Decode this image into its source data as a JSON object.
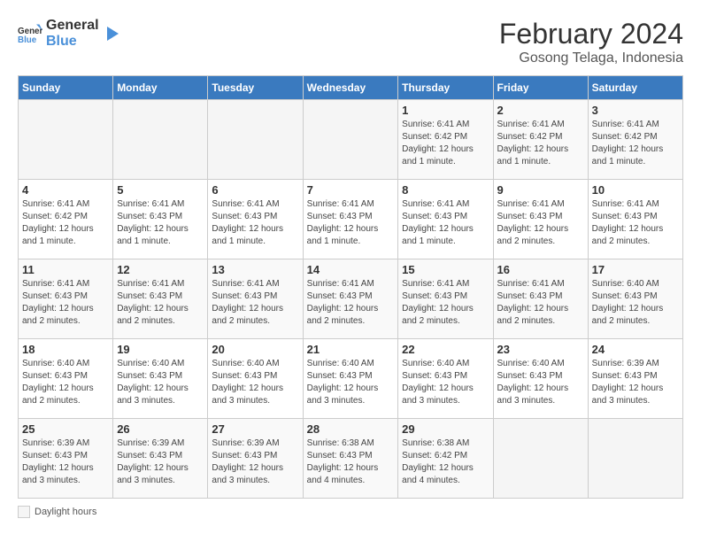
{
  "header": {
    "logo_line1": "General",
    "logo_line2": "Blue",
    "month": "February 2024",
    "location": "Gosong Telaga, Indonesia"
  },
  "days_of_week": [
    "Sunday",
    "Monday",
    "Tuesday",
    "Wednesday",
    "Thursday",
    "Friday",
    "Saturday"
  ],
  "weeks": [
    [
      {
        "num": "",
        "info": ""
      },
      {
        "num": "",
        "info": ""
      },
      {
        "num": "",
        "info": ""
      },
      {
        "num": "",
        "info": ""
      },
      {
        "num": "1",
        "info": "Sunrise: 6:41 AM\nSunset: 6:42 PM\nDaylight: 12 hours and 1 minute."
      },
      {
        "num": "2",
        "info": "Sunrise: 6:41 AM\nSunset: 6:42 PM\nDaylight: 12 hours and 1 minute."
      },
      {
        "num": "3",
        "info": "Sunrise: 6:41 AM\nSunset: 6:42 PM\nDaylight: 12 hours and 1 minute."
      }
    ],
    [
      {
        "num": "4",
        "info": "Sunrise: 6:41 AM\nSunset: 6:42 PM\nDaylight: 12 hours and 1 minute."
      },
      {
        "num": "5",
        "info": "Sunrise: 6:41 AM\nSunset: 6:43 PM\nDaylight: 12 hours and 1 minute."
      },
      {
        "num": "6",
        "info": "Sunrise: 6:41 AM\nSunset: 6:43 PM\nDaylight: 12 hours and 1 minute."
      },
      {
        "num": "7",
        "info": "Sunrise: 6:41 AM\nSunset: 6:43 PM\nDaylight: 12 hours and 1 minute."
      },
      {
        "num": "8",
        "info": "Sunrise: 6:41 AM\nSunset: 6:43 PM\nDaylight: 12 hours and 1 minute."
      },
      {
        "num": "9",
        "info": "Sunrise: 6:41 AM\nSunset: 6:43 PM\nDaylight: 12 hours and 2 minutes."
      },
      {
        "num": "10",
        "info": "Sunrise: 6:41 AM\nSunset: 6:43 PM\nDaylight: 12 hours and 2 minutes."
      }
    ],
    [
      {
        "num": "11",
        "info": "Sunrise: 6:41 AM\nSunset: 6:43 PM\nDaylight: 12 hours and 2 minutes."
      },
      {
        "num": "12",
        "info": "Sunrise: 6:41 AM\nSunset: 6:43 PM\nDaylight: 12 hours and 2 minutes."
      },
      {
        "num": "13",
        "info": "Sunrise: 6:41 AM\nSunset: 6:43 PM\nDaylight: 12 hours and 2 minutes."
      },
      {
        "num": "14",
        "info": "Sunrise: 6:41 AM\nSunset: 6:43 PM\nDaylight: 12 hours and 2 minutes."
      },
      {
        "num": "15",
        "info": "Sunrise: 6:41 AM\nSunset: 6:43 PM\nDaylight: 12 hours and 2 minutes."
      },
      {
        "num": "16",
        "info": "Sunrise: 6:41 AM\nSunset: 6:43 PM\nDaylight: 12 hours and 2 minutes."
      },
      {
        "num": "17",
        "info": "Sunrise: 6:40 AM\nSunset: 6:43 PM\nDaylight: 12 hours and 2 minutes."
      }
    ],
    [
      {
        "num": "18",
        "info": "Sunrise: 6:40 AM\nSunset: 6:43 PM\nDaylight: 12 hours and 2 minutes."
      },
      {
        "num": "19",
        "info": "Sunrise: 6:40 AM\nSunset: 6:43 PM\nDaylight: 12 hours and 3 minutes."
      },
      {
        "num": "20",
        "info": "Sunrise: 6:40 AM\nSunset: 6:43 PM\nDaylight: 12 hours and 3 minutes."
      },
      {
        "num": "21",
        "info": "Sunrise: 6:40 AM\nSunset: 6:43 PM\nDaylight: 12 hours and 3 minutes."
      },
      {
        "num": "22",
        "info": "Sunrise: 6:40 AM\nSunset: 6:43 PM\nDaylight: 12 hours and 3 minutes."
      },
      {
        "num": "23",
        "info": "Sunrise: 6:40 AM\nSunset: 6:43 PM\nDaylight: 12 hours and 3 minutes."
      },
      {
        "num": "24",
        "info": "Sunrise: 6:39 AM\nSunset: 6:43 PM\nDaylight: 12 hours and 3 minutes."
      }
    ],
    [
      {
        "num": "25",
        "info": "Sunrise: 6:39 AM\nSunset: 6:43 PM\nDaylight: 12 hours and 3 minutes."
      },
      {
        "num": "26",
        "info": "Sunrise: 6:39 AM\nSunset: 6:43 PM\nDaylight: 12 hours and 3 minutes."
      },
      {
        "num": "27",
        "info": "Sunrise: 6:39 AM\nSunset: 6:43 PM\nDaylight: 12 hours and 3 minutes."
      },
      {
        "num": "28",
        "info": "Sunrise: 6:38 AM\nSunset: 6:43 PM\nDaylight: 12 hours and 4 minutes."
      },
      {
        "num": "29",
        "info": "Sunrise: 6:38 AM\nSunset: 6:42 PM\nDaylight: 12 hours and 4 minutes."
      },
      {
        "num": "",
        "info": ""
      },
      {
        "num": "",
        "info": ""
      }
    ]
  ],
  "legend": {
    "daylight_label": "Daylight hours"
  }
}
